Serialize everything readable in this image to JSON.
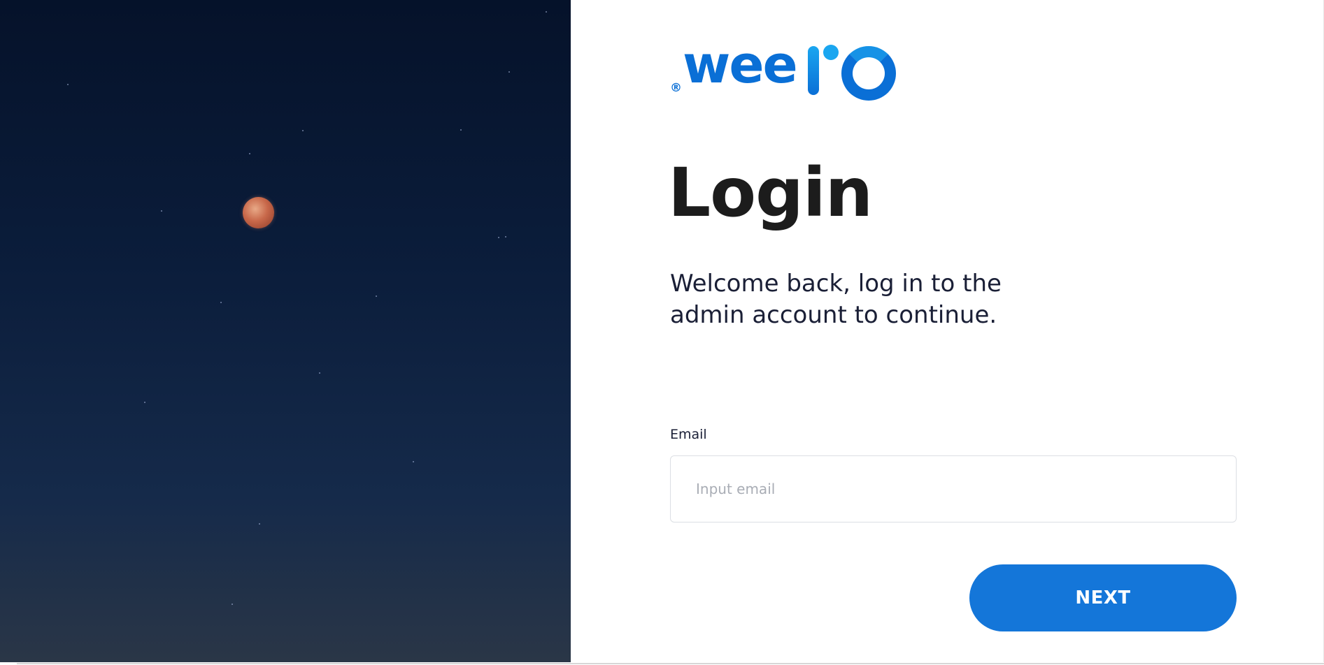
{
  "hero": {
    "background_colors": [
      "#05122a",
      "#0b1d3b",
      "#152a4a",
      "#2a3647"
    ],
    "moon_color": "#c8684a"
  },
  "logo": {
    "registered": "®",
    "wordmark": "wee",
    "suffix_mark": "IO",
    "brand_color": "#0a6fd6",
    "accent_color": "#1aa6f0"
  },
  "login": {
    "title": "Login",
    "subtitle_line1": "Welcome back, log in to the",
    "subtitle_line2": "admin account to continue.",
    "email_label": "Email",
    "email_placeholder": "Input email",
    "email_value": "",
    "next_label": "NEXT",
    "button_color": "#1476d9"
  }
}
